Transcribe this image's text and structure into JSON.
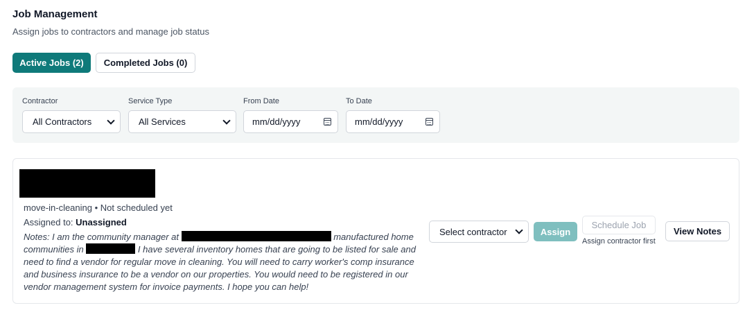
{
  "header": {
    "title": "Job Management",
    "subtitle": "Assign jobs to contractors and manage job status"
  },
  "tabs": [
    {
      "label": "Active Jobs (2)",
      "active": true
    },
    {
      "label": "Completed Jobs (0)",
      "active": false
    }
  ],
  "filters": {
    "contractor": {
      "label": "Contractor",
      "value": "All Contractors"
    },
    "service_type": {
      "label": "Service Type",
      "value": "All Services"
    },
    "from_date": {
      "label": "From Date",
      "placeholder": "mm/dd/yyyy"
    },
    "to_date": {
      "label": "To Date",
      "placeholder": "mm/dd/yyyy"
    }
  },
  "job": {
    "meta": "move-in-cleaning • Not scheduled yet",
    "assigned_prefix": "Assigned to: ",
    "assigned_value": "Unassigned",
    "notes_part1": "Notes: I am the community manager at ",
    "notes_part2": " manufactured home communities in ",
    "notes_part3": " I have several inventory homes that are going to be listed for sale and need to find a vendor for regular move in cleaning. You will need to carry worker's comp insurance and business insurance to be a vendor on our properties. You would need to be registered in our vendor management system for invoice payments. I hope you can help!",
    "actions": {
      "select_contractor": "Select contractor",
      "assign": "Assign",
      "schedule": "Schedule Job",
      "schedule_hint": "Assign contractor first",
      "view_notes": "View Notes"
    }
  },
  "colors": {
    "accent": "#0f7a7a",
    "accent_disabled": "#7fbfbf",
    "filter_bg": "#f3f6f6"
  }
}
